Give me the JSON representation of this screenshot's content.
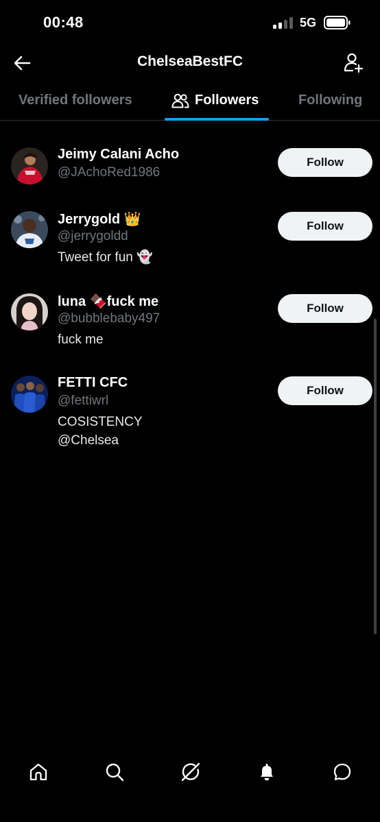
{
  "status_bar": {
    "time": "00:48",
    "network": "5G"
  },
  "header": {
    "title": "ChelseaBestFC",
    "back_icon": "arrow-left-icon",
    "add_icon": "person-plus-icon"
  },
  "tabs": [
    {
      "label": "Verified followers",
      "active": false
    },
    {
      "label": "Followers",
      "active": true,
      "icon": "people-icon"
    },
    {
      "label": "Following",
      "active": false
    }
  ],
  "users": [
    {
      "name": "Jeimy Calani Acho",
      "handle": "@JAchoRed1986",
      "bio": [],
      "follow_label": "Follow"
    },
    {
      "name": "Jerrygold 👑",
      "handle": "@jerrygoldd",
      "bio": [
        "Tweet for fun 👻"
      ],
      "follow_label": "Follow"
    },
    {
      "name": "luna 🍫fuck me",
      "handle": "@bubblebaby497",
      "bio": [
        "fuck me"
      ],
      "follow_label": "Follow"
    },
    {
      "name": "FETTI CFC",
      "handle": "@fettiwrl",
      "bio": [
        "COSISTENCY",
        "@Chelsea"
      ],
      "follow_label": "Follow"
    }
  ],
  "bottom_nav": [
    "home-icon",
    "search-icon",
    "grok-icon",
    "notifications-icon",
    "messages-icon"
  ],
  "colors": {
    "background": "#000000",
    "accent": "#1d9bf0",
    "muted_text": "#71767b",
    "button_bg": "#eff3f4"
  }
}
